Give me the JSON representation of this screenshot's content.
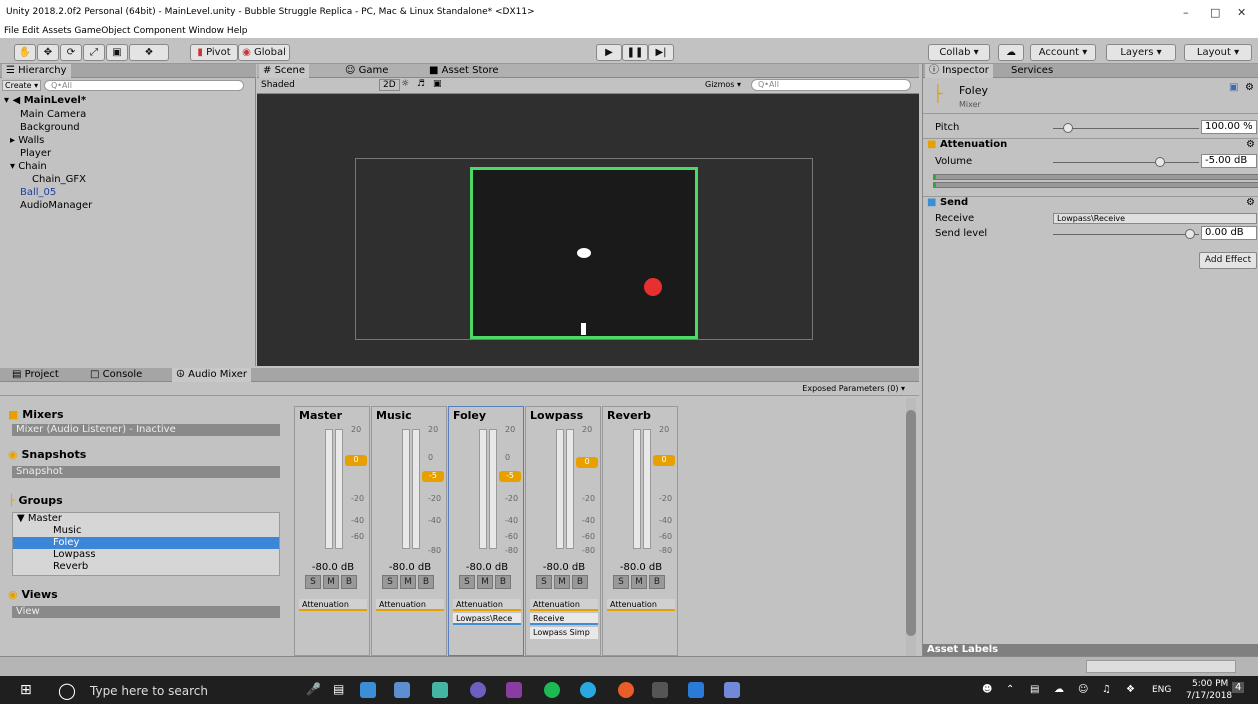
{
  "window": {
    "title": "Unity 2018.2.0f2 Personal (64bit) - MainLevel.unity - Bubble Struggle Replica - PC, Mac & Linux Standalone* <DX11>"
  },
  "menu": [
    "File",
    "Edit",
    "Assets",
    "GameObject",
    "Component",
    "Window",
    "Help"
  ],
  "toolbar": {
    "pivot": "Pivot",
    "global": "Global",
    "collab": "Collab ▾",
    "account": "Account ▾",
    "layers": "Layers ▾",
    "layout": "Layout ▾"
  },
  "hierarchy": {
    "tab": "Hierarchy",
    "create": "Create ▾",
    "search_placeholder": "Q•All",
    "scene": "MainLevel*",
    "items": [
      "Main Camera",
      "Background",
      "Walls",
      "Player",
      "Chain",
      "Chain_GFX",
      "Ball_05",
      "AudioManager"
    ]
  },
  "scene": {
    "tabs": [
      "Scene",
      "Game",
      "Asset Store"
    ],
    "shading": "Shaded",
    "mode2d": "2D",
    "gizmos": "Gizmos ▾",
    "search_placeholder": "Q•All"
  },
  "bottom": {
    "tabs": [
      "Project",
      "Console",
      "Audio Mixer"
    ],
    "exposed": "Exposed Parameters (0) ▾"
  },
  "mixers": {
    "title": "Mixers",
    "item": "Mixer  (Audio Listener) - Inactive",
    "snapshots_title": "Snapshots",
    "snapshot": "Snapshot",
    "groups_title": "Groups",
    "groups": [
      "▼ Master",
      "Music",
      "Foley",
      "Lowpass",
      "Reverb"
    ],
    "views_title": "Views",
    "view": "View"
  },
  "strips": [
    {
      "name": "Master",
      "db": "-80.0 dB",
      "badge": "0",
      "effects": [
        "Attenuation"
      ]
    },
    {
      "name": "Music",
      "db": "-80.0 dB",
      "badge": "-5",
      "effects": [
        "Attenuation"
      ]
    },
    {
      "name": "Foley",
      "db": "-80.0 dB",
      "badge": "-5",
      "effects": [
        "Attenuation",
        "Lowpass\\Rece"
      ]
    },
    {
      "name": "Lowpass",
      "db": "-80.0 dB",
      "badge": "0",
      "effects": [
        "Attenuation",
        "Receive",
        "Lowpass Simp"
      ]
    },
    {
      "name": "Reverb",
      "db": "-80.0 dB",
      "badge": "0",
      "effects": [
        "Attenuation"
      ]
    }
  ],
  "scale": [
    "20",
    "0",
    "-20",
    "-40",
    "-60",
    "-80"
  ],
  "smb": [
    "S",
    "M",
    "B"
  ],
  "inspector": {
    "tabs": [
      "Inspector",
      "Services"
    ],
    "object": "Foley",
    "type": "Mixer",
    "pitch_label": "Pitch",
    "pitch_value": "100.00 %",
    "attenuation": "Attenuation",
    "volume_label": "Volume",
    "volume_value": "-5.00 dB",
    "send": "Send",
    "receive_label": "Receive",
    "receive_value": "Lowpass\\Receive",
    "send_level_label": "Send level",
    "send_level_value": "0.00 dB",
    "add_effect": "Add Effect",
    "asset_labels": "Asset Labels"
  },
  "taskbar": {
    "search": "Type here to search",
    "lang": "ENG",
    "time": "5:00 PM",
    "date": "7/17/2018",
    "notif": "4"
  }
}
